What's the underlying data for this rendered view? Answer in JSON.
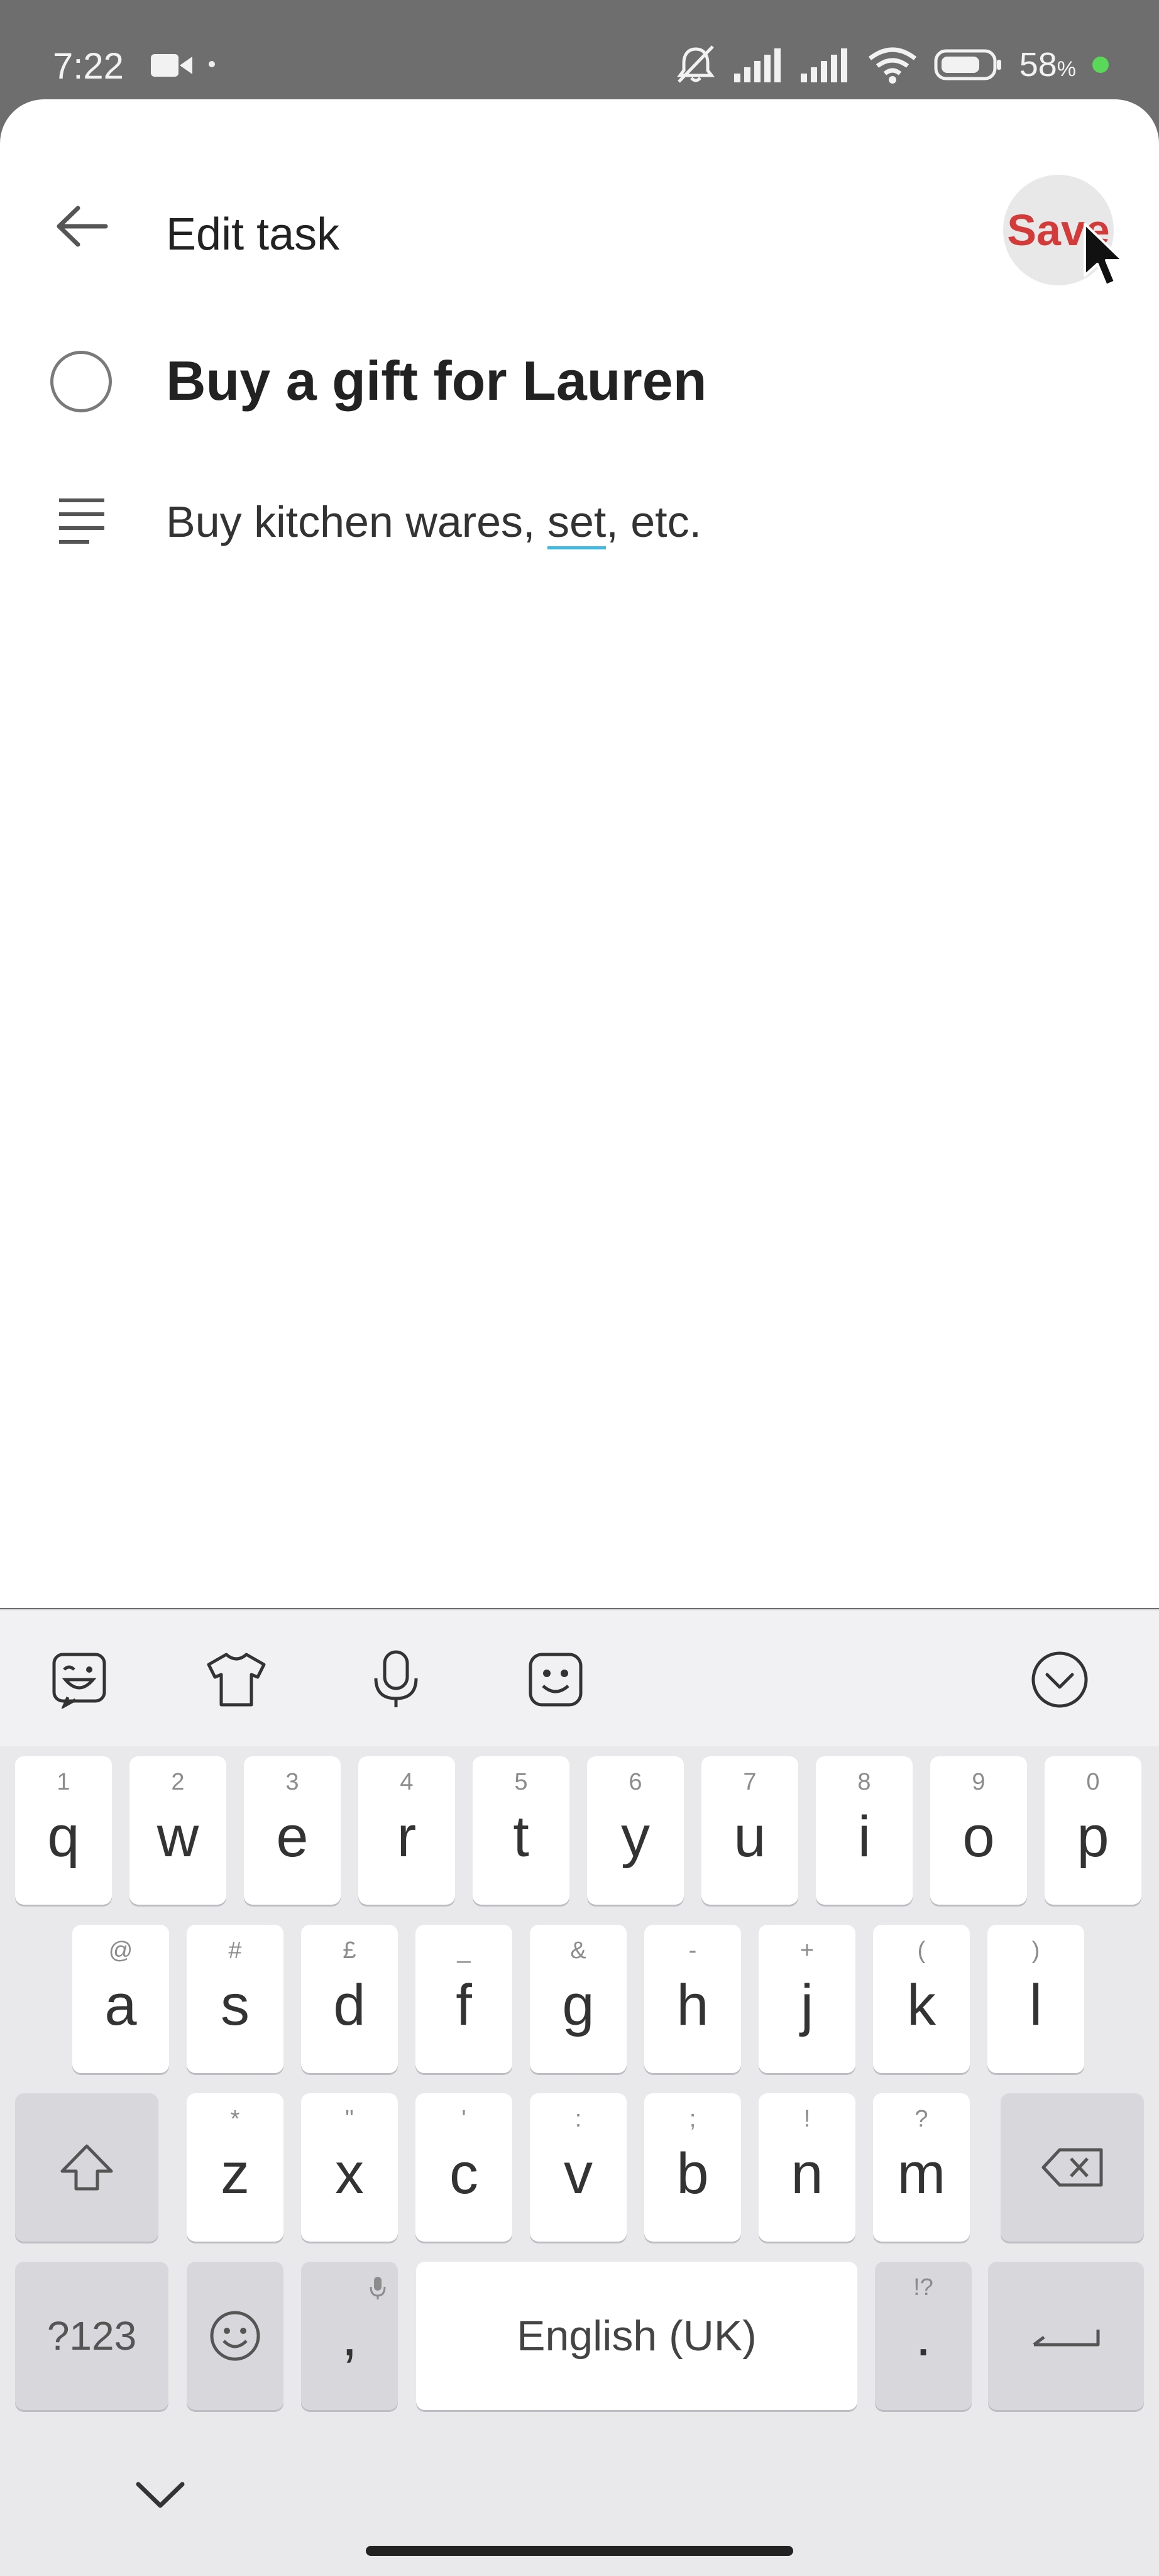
{
  "status_bar": {
    "time": "7:22",
    "battery_percent": "58",
    "battery_suffix": "%",
    "icons": [
      "video-camera-icon",
      "notifications-muted-icon",
      "signal-icon",
      "signal-icon",
      "wifi-icon",
      "battery-icon",
      "privacy-indicator-dot"
    ]
  },
  "header": {
    "title": "Edit task",
    "save_label": "Save",
    "back_icon": "arrow-left-icon"
  },
  "task": {
    "title": "Buy a gift for Lauren",
    "notes_before": "Buy kitchen wares, ",
    "notes_marked": "set",
    "notes_after": ", etc."
  },
  "keyboard": {
    "toolbar_icons": [
      "sticker-icon",
      "theme-shirt-icon",
      "microphone-icon",
      "emoji-face-icon",
      "collapse-chevron-icon"
    ],
    "row1": [
      {
        "key": "q",
        "hint": "1"
      },
      {
        "key": "w",
        "hint": "2"
      },
      {
        "key": "e",
        "hint": "3"
      },
      {
        "key": "r",
        "hint": "4"
      },
      {
        "key": "t",
        "hint": "5"
      },
      {
        "key": "y",
        "hint": "6"
      },
      {
        "key": "u",
        "hint": "7"
      },
      {
        "key": "i",
        "hint": "8"
      },
      {
        "key": "o",
        "hint": "9"
      },
      {
        "key": "p",
        "hint": "0"
      }
    ],
    "row2": [
      {
        "key": "a",
        "hint": "@"
      },
      {
        "key": "s",
        "hint": "#"
      },
      {
        "key": "d",
        "hint": "£"
      },
      {
        "key": "f",
        "hint": "_"
      },
      {
        "key": "g",
        "hint": "&"
      },
      {
        "key": "h",
        "hint": "-"
      },
      {
        "key": "j",
        "hint": "+"
      },
      {
        "key": "k",
        "hint": "("
      },
      {
        "key": "l",
        "hint": ")"
      }
    ],
    "row3": [
      {
        "key": "z",
        "hint": "*"
      },
      {
        "key": "x",
        "hint": "\""
      },
      {
        "key": "c",
        "hint": "'"
      },
      {
        "key": "v",
        "hint": ":"
      },
      {
        "key": "b",
        "hint": ";"
      },
      {
        "key": "n",
        "hint": "!"
      },
      {
        "key": "m",
        "hint": "?"
      }
    ],
    "symbols_label": "?123",
    "comma_label": ",",
    "space_label": "English (UK)",
    "period_label": ".",
    "period_hint": "!?"
  }
}
